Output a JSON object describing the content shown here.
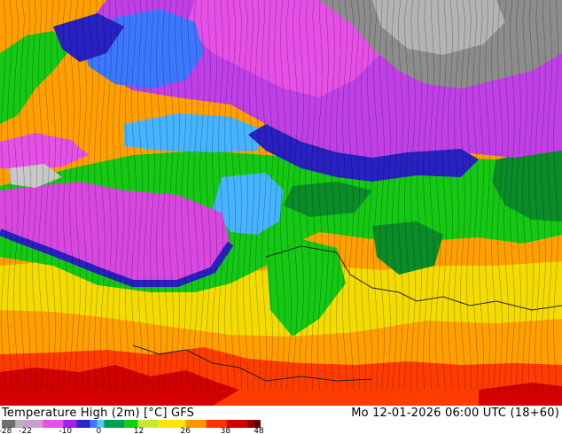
{
  "footer": {
    "title": "Temperature High (2m) [°C] GFS",
    "valid_time": "Mo 12-01-2026 06:00 UTC (18+60)"
  },
  "legend": {
    "ticks": [
      "-28",
      "-22",
      "-10",
      "0",
      "12",
      "26",
      "38",
      "48"
    ],
    "stops": [
      {
        "value": -28,
        "color": "#6e6e6e"
      },
      {
        "value": -24,
        "color": "#b4b4b4"
      },
      {
        "value": -22,
        "color": "#c8a0c8"
      },
      {
        "value": -16,
        "color": "#e650e6"
      },
      {
        "value": -10,
        "color": "#a020f0"
      },
      {
        "value": -6,
        "color": "#2828c8"
      },
      {
        "value": -2,
        "color": "#3c78ff"
      },
      {
        "value": 0,
        "color": "#50c8ff"
      },
      {
        "value": 2,
        "color": "#00a050"
      },
      {
        "value": 8,
        "color": "#10d010"
      },
      {
        "value": 12,
        "color": "#c8e632"
      },
      {
        "value": 18,
        "color": "#ffe600"
      },
      {
        "value": 26,
        "color": "#ff9600"
      },
      {
        "value": 32,
        "color": "#ff3200"
      },
      {
        "value": 38,
        "color": "#d20000"
      },
      {
        "value": 44,
        "color": "#8c0000"
      },
      {
        "value": 48,
        "color": "#460000"
      }
    ]
  },
  "map_colors": {
    "very_cold": "#8c8c8c",
    "cold_magenta": "#e650e6",
    "purple": "#b040e0",
    "dark_blue": "#2820c0",
    "blue": "#3c78ff",
    "cyan": "#46b4ff",
    "dark_green": "#0a8c28",
    "green": "#10c010",
    "yellow": "#f0e600",
    "orange": "#ffa000",
    "red": "#ff2800",
    "dark_red": "#c80000"
  }
}
